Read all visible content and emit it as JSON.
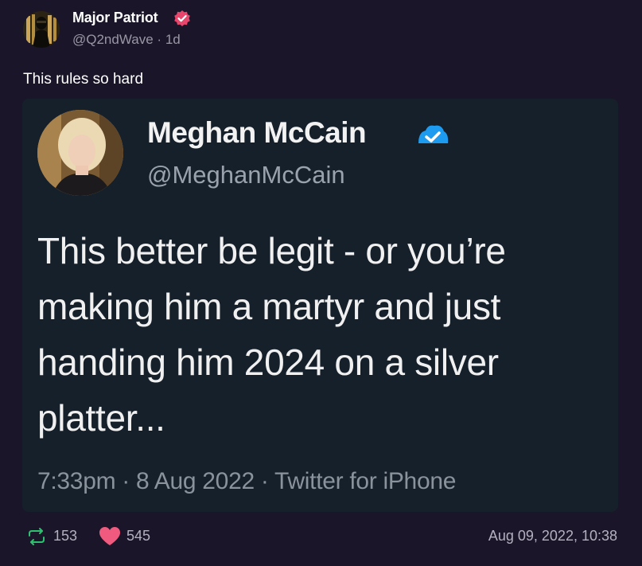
{
  "post": {
    "author_name": "Major Patriot",
    "handle": "@Q2ndWave",
    "separator": "·",
    "age": "1d",
    "text": "This rules so hard",
    "retweets": "153",
    "likes": "545",
    "timestamp": "Aug 09, 2022, 10:38"
  },
  "embedded_tweet": {
    "author_name": "Meghan McCain",
    "handle": "@MeghanMcCain",
    "text": "This better be legit - or you’re making him a martyr and just handing him 2024 on a silver platter...",
    "meta": "7:33pm · 8 Aug 2022 · Twitter for iPhone"
  },
  "colors": {
    "background": "#1a1528",
    "embedded_background": "#16202b",
    "verified_pink": "#e8466c",
    "twitter_blue": "#1d9bf0",
    "retweet_green": "#2fbf71",
    "like_pink": "#f05a7e"
  },
  "icons": {
    "verified": "verified-badge-icon",
    "twitter_verified": "twitter-verified-badge-icon",
    "retweet": "retweet-icon",
    "like": "heart-icon"
  }
}
